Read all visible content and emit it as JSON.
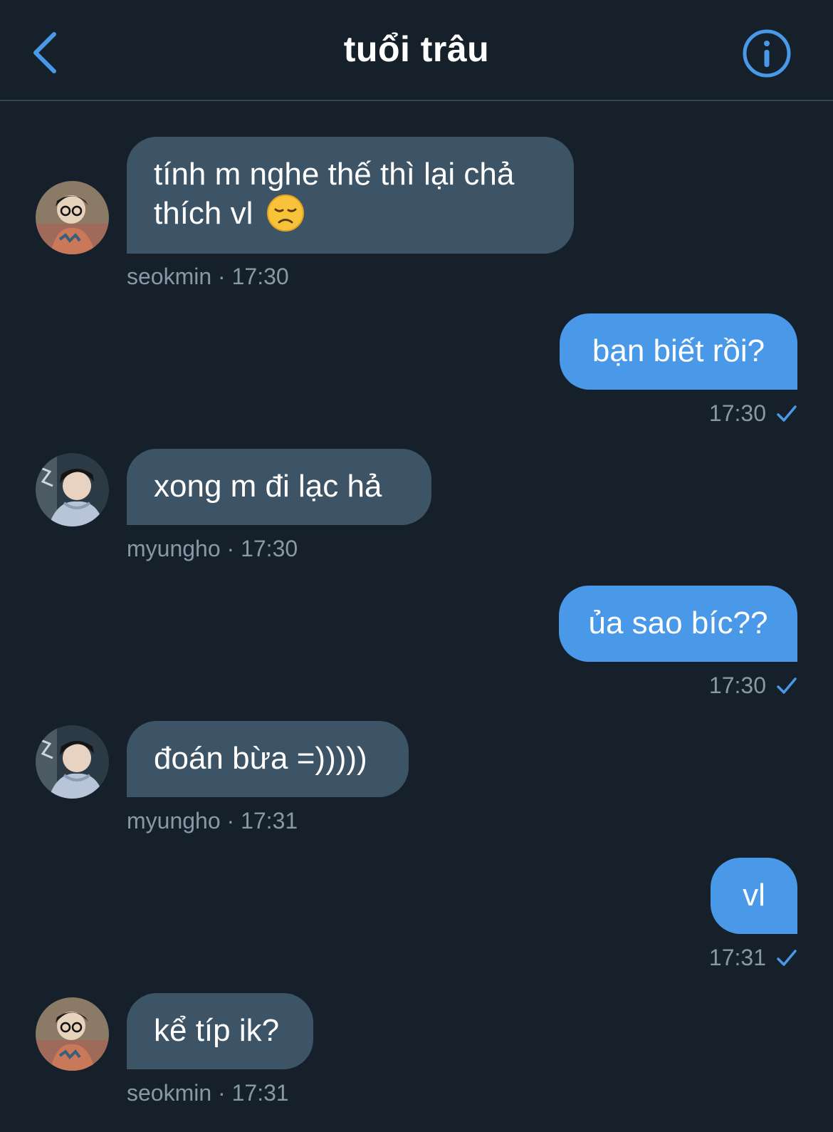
{
  "header": {
    "title": "tuổi trâu"
  },
  "colors": {
    "background": "#15202b",
    "incoming_bubble": "#3d5466",
    "outgoing_bubble": "#4a99e9",
    "accent": "#4a99e9",
    "meta_text": "#8899a6"
  },
  "messages": [
    {
      "direction": "in",
      "text": "tính m nghe thế thì lại chả thích vl",
      "emoji": "disappointed-face-icon",
      "sender": "seokmin",
      "time": "17:30",
      "meta": "seokmin · 17:30"
    },
    {
      "direction": "out",
      "text": "bạn biết rồi?",
      "time": "17:30",
      "status": "check-icon"
    },
    {
      "direction": "in",
      "text": "xong m đi lạc hả",
      "sender": "myungho",
      "time": "17:30",
      "meta": "myungho · 17:30"
    },
    {
      "direction": "out",
      "text": "ủa sao bíc??",
      "time": "17:30",
      "status": "check-icon"
    },
    {
      "direction": "in",
      "text": "đoán bừa =)))))",
      "sender": "myungho",
      "time": "17:31",
      "meta": "myungho · 17:31"
    },
    {
      "direction": "out",
      "text": "vl",
      "time": "17:31",
      "status": "check-icon"
    },
    {
      "direction": "in",
      "text": "kể típ ik?",
      "sender": "seokmin",
      "time": "17:31",
      "meta": "seokmin · 17:31"
    }
  ]
}
